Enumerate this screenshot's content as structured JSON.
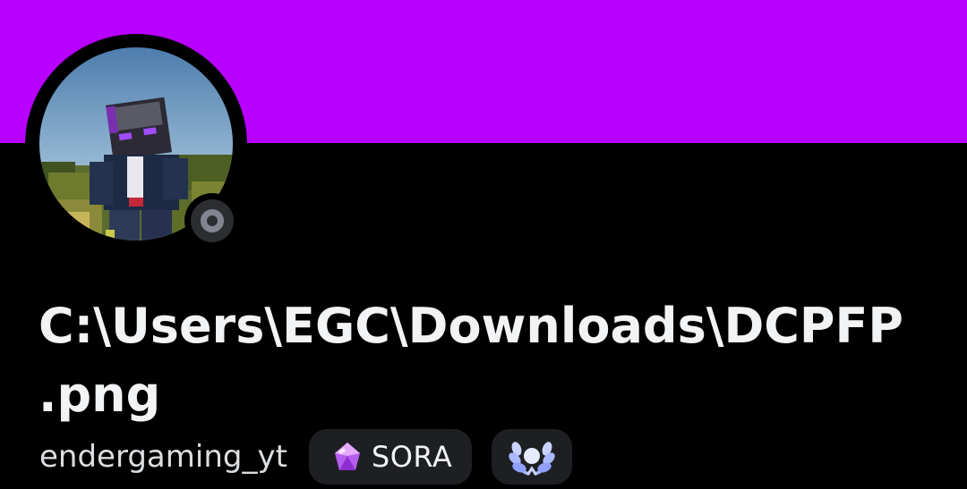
{
  "profile": {
    "banner_color": "#b700ff",
    "display_name_line1": "C:\\Users\\EGC\\Downloads\\DCPFP",
    "display_name_line2": ".png",
    "username": "endergaming_yt",
    "status": "offline",
    "avatar_icon": "minecraft-enderman-avatar-icon"
  },
  "tags": {
    "guild_tag_label": "SORA",
    "guild_tag_icon": "purple-gem-icon",
    "badge_icon": "laurel-wreath-badge-icon"
  }
}
